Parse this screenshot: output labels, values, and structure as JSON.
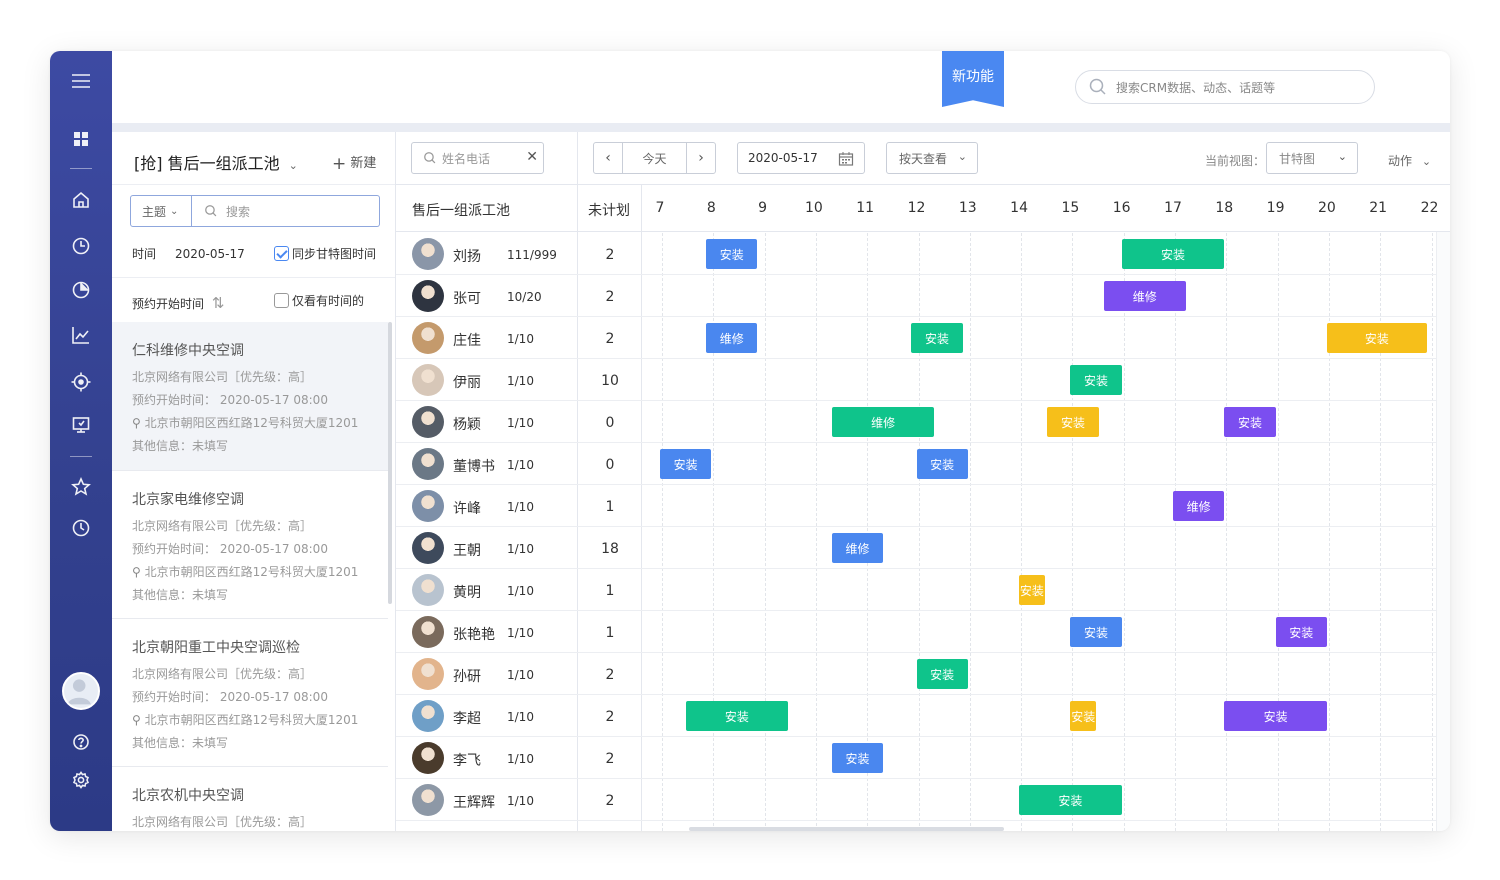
{
  "topbar": {
    "new_feature": "新功能",
    "search_placeholder": "搜索CRM数据、动态、话题等"
  },
  "sidebar": {
    "icons": [
      "menu-icon",
      "apps-icon",
      "home-icon",
      "clock-icon",
      "pie-chart-icon",
      "line-chart-icon",
      "target-icon",
      "screen-icon",
      "star-icon",
      "history-icon",
      "help-icon",
      "settings-icon"
    ]
  },
  "left_panel": {
    "title": "[抢]  售后一组派工池",
    "new_label": "新建",
    "filter_select": "主题",
    "search_placeholder": "搜索",
    "time_label": "时间",
    "time_value": "2020-05-17",
    "sync_label": "同步甘特图时间",
    "sort_label": "预约开始时间",
    "only_time_label": "仅看有时间的",
    "cards": [
      {
        "title": "仁科维修中央空调",
        "company": "北京网络有限公司［优先级：高］",
        "appt": "预约开始时间：  2020-05-17   08:00",
        "address": "北京市朝阳区西红路12号科贸大厦1201",
        "other": "其他信息：未填写"
      },
      {
        "title": "北京家电维修空调",
        "company": "北京网络有限公司［优先级：高］",
        "appt": "预约开始时间：  2020-05-17   08:00",
        "address": "北京市朝阳区西红路12号科贸大厦1201",
        "other": "其他信息：未填写"
      },
      {
        "title": "北京朝阳重工中央空调巡检",
        "company": "北京网络有限公司［优先级：高］",
        "appt": "预约开始时间：  2020-05-17   08:00",
        "address": "北京市朝阳区西红路12号科贸大厦1201",
        "other": "其他信息：未填写"
      },
      {
        "title": "北京农机中央空调",
        "company": "北京网络有限公司［优先级：高］",
        "appt": "",
        "address": "",
        "other": ""
      }
    ]
  },
  "toolbar": {
    "name_phone_placeholder": "姓名电话",
    "today": "今天",
    "date": "2020-05-17",
    "view_by": "按天查看",
    "current_view_label": "当前视图：",
    "current_view": "甘特图",
    "action": "动作"
  },
  "gantt": {
    "pool_label": "售后一组派工池",
    "unplanned_label": "未计划",
    "hours": [
      "7",
      "8",
      "9",
      "10",
      "11",
      "12",
      "13",
      "14",
      "15",
      "16",
      "17",
      "18",
      "19",
      "20",
      "21",
      "22"
    ],
    "rows": [
      {
        "name": "刘扬",
        "count": "111/999",
        "unplanned": "2",
        "bars": [
          {
            "start": 7.9,
            "end": 8.9,
            "label": "安装",
            "color": "#4a87ef"
          },
          {
            "start": 16.0,
            "end": 18.0,
            "label": "安装",
            "color": "#0fc48b"
          }
        ]
      },
      {
        "name": "张可",
        "count": "10/20",
        "unplanned": "2",
        "bars": [
          {
            "start": 15.65,
            "end": 17.25,
            "label": "维修",
            "color": "#7b4ef0"
          }
        ]
      },
      {
        "name": "庄佳",
        "count": "1/10",
        "unplanned": "2",
        "bars": [
          {
            "start": 7.9,
            "end": 8.9,
            "label": "维修",
            "color": "#4a87ef"
          },
          {
            "start": 11.9,
            "end": 12.9,
            "label": "安装",
            "color": "#0fc48b"
          },
          {
            "start": 20.0,
            "end": 21.95,
            "label": "安装",
            "color": "#f6bf1a"
          }
        ]
      },
      {
        "name": "伊丽",
        "count": "1/10",
        "unplanned": "10",
        "bars": [
          {
            "start": 15.0,
            "end": 16.0,
            "label": "安装",
            "color": "#0fc48b"
          }
        ]
      },
      {
        "name": "杨颖",
        "count": "1/10",
        "unplanned": "0",
        "bars": [
          {
            "start": 10.35,
            "end": 12.35,
            "label": "维修",
            "color": "#0fc48b"
          },
          {
            "start": 14.55,
            "end": 15.55,
            "label": "安装",
            "color": "#f6bf1a"
          },
          {
            "start": 18.0,
            "end": 19.0,
            "label": "安装",
            "color": "#7b4ef0"
          }
        ]
      },
      {
        "name": "董博书",
        "count": "1/10",
        "unplanned": "0",
        "bars": [
          {
            "start": 7.0,
            "end": 8.0,
            "label": "安装",
            "color": "#4a87ef"
          },
          {
            "start": 12.0,
            "end": 13.0,
            "label": "安装",
            "color": "#4a87ef"
          }
        ]
      },
      {
        "name": "许峰",
        "count": "1/10",
        "unplanned": "1",
        "bars": [
          {
            "start": 17.0,
            "end": 18.0,
            "label": "维修",
            "color": "#7b4ef0"
          }
        ]
      },
      {
        "name": "王朝",
        "count": "1/10",
        "unplanned": "18",
        "bars": [
          {
            "start": 10.35,
            "end": 11.35,
            "label": "维修",
            "color": "#4a87ef"
          }
        ]
      },
      {
        "name": "黄明",
        "count": "1/10",
        "unplanned": "1",
        "bars": [
          {
            "start": 14.0,
            "end": 14.5,
            "label": "安装",
            "color": "#f6bf1a"
          }
        ]
      },
      {
        "name": "张艳艳",
        "count": "1/10",
        "unplanned": "1",
        "bars": [
          {
            "start": 15.0,
            "end": 16.0,
            "label": "安装",
            "color": "#4a87ef"
          },
          {
            "start": 19.0,
            "end": 20.0,
            "label": "安装",
            "color": "#7b4ef0"
          }
        ]
      },
      {
        "name": "孙研",
        "count": "1/10",
        "unplanned": "2",
        "bars": [
          {
            "start": 12.0,
            "end": 13.0,
            "label": "安装",
            "color": "#0fc48b"
          }
        ]
      },
      {
        "name": "李超",
        "count": "1/10",
        "unplanned": "2",
        "bars": [
          {
            "start": 7.5,
            "end": 9.5,
            "label": "安装",
            "color": "#0fc48b"
          },
          {
            "start": 15.0,
            "end": 15.5,
            "label": "安装",
            "color": "#f6bf1a"
          },
          {
            "start": 18.0,
            "end": 20.0,
            "label": "安装",
            "color": "#7b4ef0"
          }
        ]
      },
      {
        "name": "李飞",
        "count": "1/10",
        "unplanned": "2",
        "bars": [
          {
            "start": 10.35,
            "end": 11.35,
            "label": "安装",
            "color": "#4a87ef"
          }
        ]
      },
      {
        "name": "王辉辉",
        "count": "1/10",
        "unplanned": "2",
        "bars": [
          {
            "start": 14.0,
            "end": 16.0,
            "label": "安装",
            "color": "#0fc48b"
          }
        ]
      }
    ]
  }
}
